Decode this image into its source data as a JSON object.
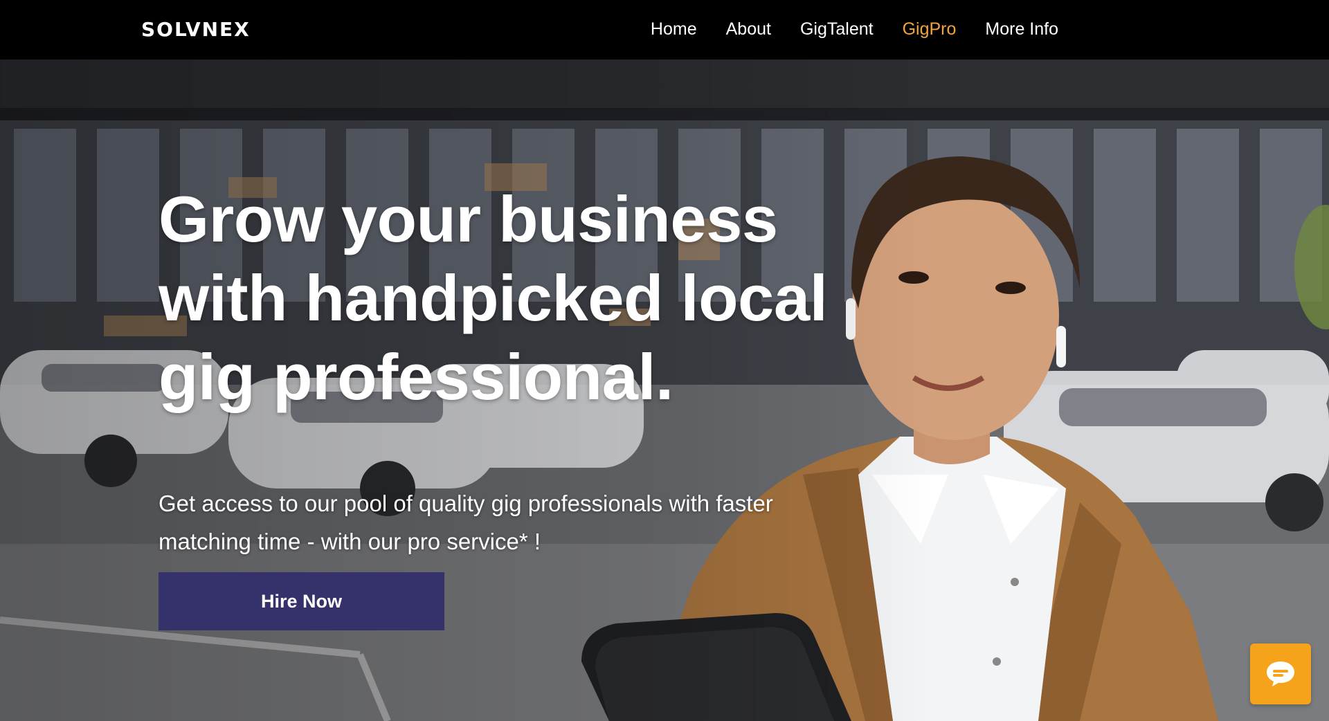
{
  "header": {
    "logo": "SOLVNEX",
    "nav": [
      {
        "label": "Home",
        "active": false
      },
      {
        "label": "About",
        "active": false
      },
      {
        "label": "GigTalent",
        "active": false
      },
      {
        "label": "GigPro",
        "active": true
      },
      {
        "label": "More Info",
        "active": false
      }
    ]
  },
  "hero": {
    "headline": "Grow your business with handpicked local gig professional.",
    "subtext": "Get access to our pool of quality gig professionals with faster matching time - with our pro service* !",
    "cta_label": "Hire Now"
  },
  "chat": {
    "icon": "chat-bubble-icon"
  },
  "colors": {
    "header_bg": "#000000",
    "nav_active": "#f2a33a",
    "cta_bg": "#34316b",
    "chat_bg": "#f5a31a"
  }
}
